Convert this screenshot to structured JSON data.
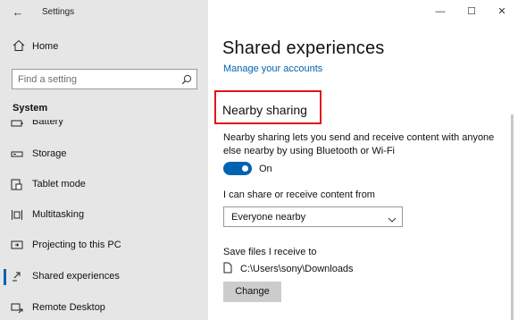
{
  "window": {
    "title": "Settings",
    "back_glyph": "←",
    "minimize_glyph": "—",
    "maximize_glyph": "☐",
    "close_glyph": "✕"
  },
  "sidebar": {
    "home_label": "Home",
    "search_placeholder": "Find a setting",
    "section_label": "System",
    "items": [
      {
        "label": "Battery",
        "icon": "battery-icon"
      },
      {
        "label": "Storage",
        "icon": "storage-icon"
      },
      {
        "label": "Tablet mode",
        "icon": "tablet-mode-icon"
      },
      {
        "label": "Multitasking",
        "icon": "multitasking-icon"
      },
      {
        "label": "Projecting to this PC",
        "icon": "projecting-icon"
      },
      {
        "label": "Shared experiences",
        "icon": "shared-experiences-icon",
        "selected": true
      },
      {
        "label": "Remote Desktop",
        "icon": "remote-desktop-icon"
      }
    ]
  },
  "main": {
    "title": "Shared experiences",
    "manage_link": "Manage your accounts",
    "nearby_heading": "Nearby sharing",
    "nearby_description": "Nearby sharing lets you send and receive content with anyone else nearby by using Bluetooth or Wi-Fi",
    "toggle_state_label": "On",
    "share_label": "I can share or receive content from",
    "dropdown_value": "Everyone nearby",
    "save_label": "Save files I receive to",
    "save_path": "C:\\Users\\sony\\Downloads",
    "change_button": "Change"
  },
  "colors": {
    "accent": "#0063b1",
    "highlight_box": "#e0151b",
    "sidebar_bg": "#e6e6e6"
  }
}
